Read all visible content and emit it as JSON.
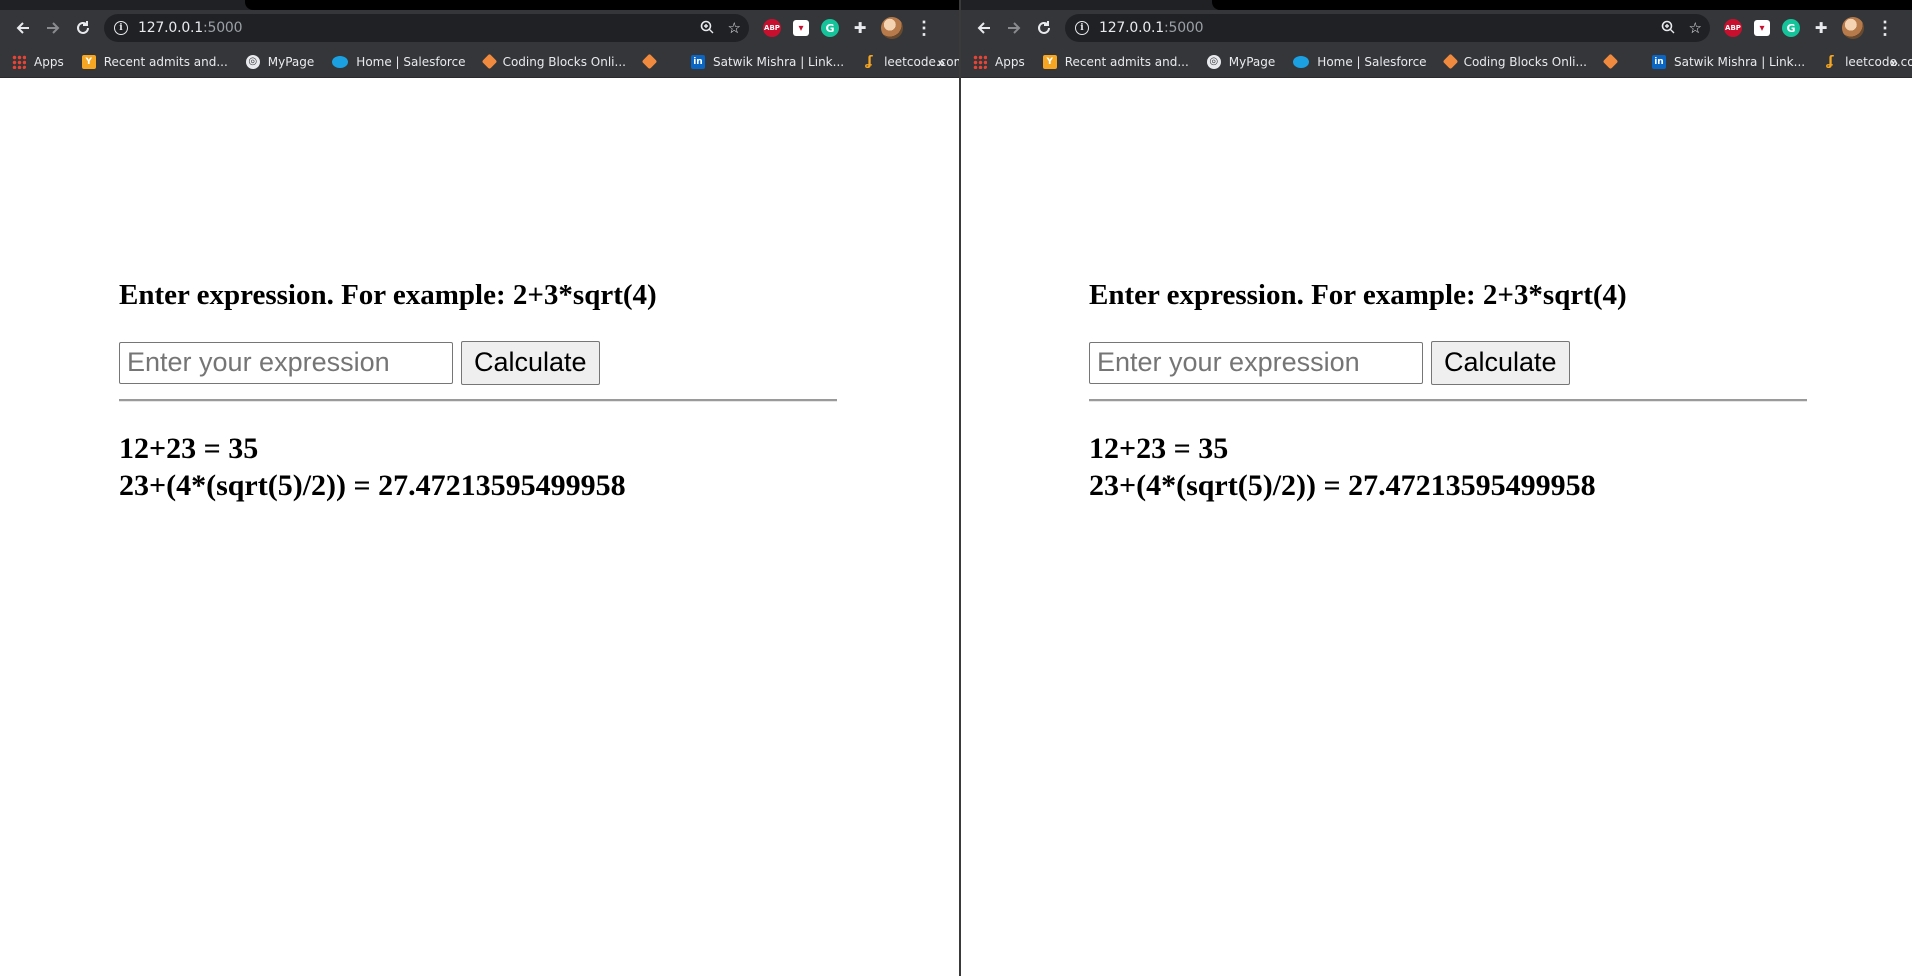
{
  "windows": [
    {
      "toolbar": {
        "back_icon": "arrow-left-icon",
        "forward_icon": "arrow-right-icon",
        "reload_icon": "reload-icon",
        "url_host": "127.0.0.1",
        "url_port": ":5000",
        "zoom_icon": "zoom-icon",
        "star_icon": "star-icon",
        "extensions": [
          "ABP",
          "pocket",
          "grammarly",
          "puzzle"
        ],
        "menu_icon": "kebab-menu-icon"
      },
      "bookmarks": [
        {
          "label": "Apps",
          "icon": "apps-grid-icon"
        },
        {
          "label": "Recent admits and...",
          "icon": "y-icon"
        },
        {
          "label": "MyPage",
          "icon": "globe-icon"
        },
        {
          "label": "Home | Salesforce",
          "icon": "salesforce-icon"
        },
        {
          "label": "Coding Blocks Onli...",
          "icon": "cube-icon"
        },
        {
          "label": "",
          "icon": "cube-icon"
        },
        {
          "label": "Satwik Mishra | Link...",
          "icon": "linkedin-icon"
        },
        {
          "label": "leetcode.com",
          "icon": "leetcode-icon"
        }
      ],
      "bookmarks_more": "»",
      "page": {
        "prompt": "Enter expression. For example: 2+3*sqrt(4)",
        "input_placeholder": "Enter your expression",
        "input_value": "",
        "button_label": "Calculate",
        "results": [
          "12+23 = 35",
          "23+(4*(sqrt(5)/2)) = 27.47213595499958"
        ]
      }
    },
    {
      "toolbar": {
        "back_icon": "arrow-left-icon",
        "forward_icon": "arrow-right-icon",
        "reload_icon": "reload-icon",
        "url_host": "127.0.0.1",
        "url_port": ":5000",
        "zoom_icon": "zoom-icon",
        "star_icon": "star-icon",
        "extensions": [
          "ABP",
          "pocket",
          "grammarly",
          "puzzle"
        ],
        "menu_icon": "kebab-menu-icon"
      },
      "bookmarks": [
        {
          "label": "Apps",
          "icon": "apps-grid-icon"
        },
        {
          "label": "Recent admits and...",
          "icon": "y-icon"
        },
        {
          "label": "MyPage",
          "icon": "globe-icon"
        },
        {
          "label": "Home | Salesforce",
          "icon": "salesforce-icon"
        },
        {
          "label": "Coding Blocks Onli...",
          "icon": "cube-icon"
        },
        {
          "label": "",
          "icon": "cube-icon"
        },
        {
          "label": "Satwik Mishra | Link...",
          "icon": "linkedin-icon"
        },
        {
          "label": "leetcode.com",
          "icon": "leetcode-icon"
        }
      ],
      "bookmarks_more": "»",
      "page": {
        "prompt": "Enter expression. For example: 2+3*sqrt(4)",
        "input_placeholder": "Enter your expression",
        "input_value": "",
        "button_label": "Calculate",
        "results": [
          "12+23 = 35",
          "23+(4*(sqrt(5)/2)) = 27.47213595499958"
        ]
      }
    }
  ],
  "colors": {
    "toolbar_bg": "#35363a",
    "omnibox_bg": "#202124",
    "toolbar_text": "#e8eaed",
    "page_bg": "#ffffff"
  }
}
